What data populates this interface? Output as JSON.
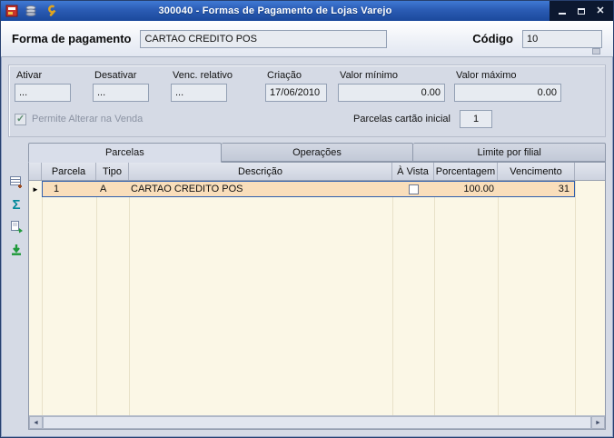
{
  "window": {
    "title": "300040 - Formas de Pagamento de Lojas Varejo"
  },
  "header": {
    "payment_form_label": "Forma de pagamento",
    "payment_form_value": "CARTAO CREDITO POS",
    "code_label": "Código",
    "code_value": "10"
  },
  "details": {
    "fields": [
      {
        "label": "Ativar",
        "value": "..."
      },
      {
        "label": "Desativar",
        "value": "..."
      },
      {
        "label": "Venc. relativo",
        "value": "..."
      },
      {
        "label": "Criação",
        "value": "17/06/2010"
      },
      {
        "label": "Valor mínimo",
        "value": "0.00"
      },
      {
        "label": "Valor máximo",
        "value": "0.00"
      }
    ],
    "allow_change_label": "Permite Alterar na Venda",
    "allow_change_checked": true,
    "initial_installments_label": "Parcelas cartão inicial",
    "initial_installments_value": "1"
  },
  "tabs": [
    {
      "label": "Parcelas"
    },
    {
      "label": "Operações"
    },
    {
      "label": "Limite por filial"
    }
  ],
  "grid": {
    "columns": [
      "Parcela",
      "Tipo",
      "Descrição",
      "À Vista",
      "Porcentagem",
      "Vencimento"
    ],
    "rows": [
      {
        "parcela": "1",
        "tipo": "A",
        "descricao": "CARTAO CREDITO POS",
        "a_vista": false,
        "porcentagem": "100.00",
        "vencimento": "31"
      }
    ]
  },
  "icons": {
    "sum_glyph": "Σ",
    "row_marker": "►",
    "scroll_left": "◄",
    "scroll_right": "►",
    "close_glyph": "✕"
  },
  "colors": {
    "titlebar_blue": "#2b5cb4",
    "grid_bg": "#fbf7e6",
    "selected_row_bg": "#f9debb",
    "selected_row_border": "#2f5fae"
  }
}
